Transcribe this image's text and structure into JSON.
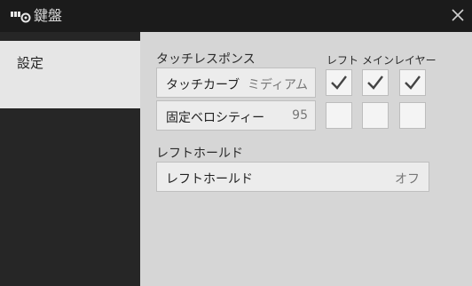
{
  "window": {
    "title": "鍵盤",
    "icon": "keyboard-settings-icon",
    "close": "close-icon"
  },
  "sidebar": {
    "tab_label": "設定"
  },
  "touch_response": {
    "section_label": "タッチレスポンス",
    "headers": [
      "レフト",
      "メイン",
      "レイヤー"
    ],
    "touch_curve": {
      "label": "タッチカーブ",
      "value": "ミディアム",
      "checks": [
        true,
        true,
        true
      ]
    },
    "fixed_velocity": {
      "label": "固定ベロシティー",
      "value": "95",
      "checks": [
        false,
        false,
        false
      ]
    }
  },
  "left_hold": {
    "section_label": "レフトホールド",
    "setting": {
      "label": "レフトホールド",
      "value": "オフ"
    }
  }
}
